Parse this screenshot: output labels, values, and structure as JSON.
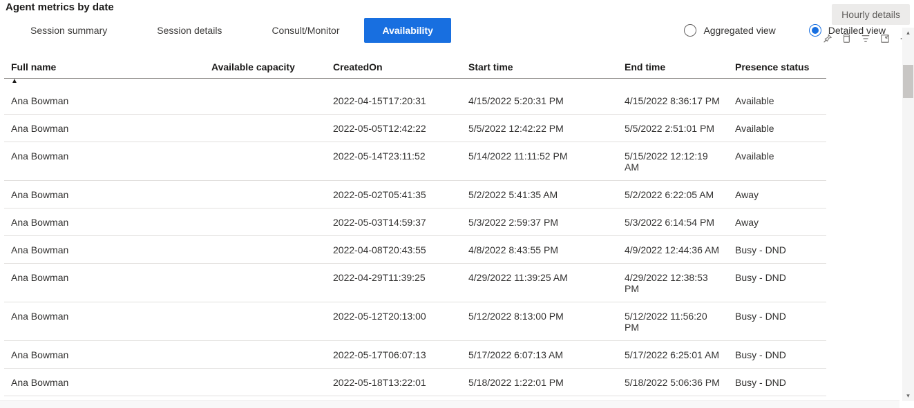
{
  "title": "Agent metrics by date",
  "tabs": [
    {
      "label": "Session summary",
      "active": false
    },
    {
      "label": "Session details",
      "active": false
    },
    {
      "label": "Consult/Monitor",
      "active": false
    },
    {
      "label": "Availability",
      "active": true
    }
  ],
  "view": {
    "aggregated_label": "Aggregated view",
    "detailed_label": "Detailed view",
    "selected": "detailed"
  },
  "right_rail": {
    "hourly_label": "Hourly details"
  },
  "columns": {
    "full_name": "Full name",
    "available_capacity": "Available capacity",
    "created_on": "CreatedOn",
    "start_time": "Start time",
    "end_time": "End time",
    "presence_status": "Presence status"
  },
  "sort_indicator": "▲",
  "rows": [
    {
      "name": "Ana Bowman",
      "capacity": "",
      "created": "2022-04-15T17:20:31",
      "start": "4/15/2022 5:20:31 PM",
      "end": "4/15/2022 8:36:17 PM",
      "status": "Available"
    },
    {
      "name": "Ana Bowman",
      "capacity": "",
      "created": "2022-05-05T12:42:22",
      "start": "5/5/2022 12:42:22 PM",
      "end": "5/5/2022 2:51:01 PM",
      "status": "Available"
    },
    {
      "name": "Ana Bowman",
      "capacity": "",
      "created": "2022-05-14T23:11:52",
      "start": "5/14/2022 11:11:52 PM",
      "end": "5/15/2022 12:12:19 AM",
      "status": "Available"
    },
    {
      "name": "Ana Bowman",
      "capacity": "",
      "created": "2022-05-02T05:41:35",
      "start": "5/2/2022 5:41:35 AM",
      "end": "5/2/2022 6:22:05 AM",
      "status": "Away"
    },
    {
      "name": "Ana Bowman",
      "capacity": "",
      "created": "2022-05-03T14:59:37",
      "start": "5/3/2022 2:59:37 PM",
      "end": "5/3/2022 6:14:54 PM",
      "status": "Away"
    },
    {
      "name": "Ana Bowman",
      "capacity": "",
      "created": "2022-04-08T20:43:55",
      "start": "4/8/2022 8:43:55 PM",
      "end": "4/9/2022 12:44:36 AM",
      "status": "Busy - DND"
    },
    {
      "name": "Ana Bowman",
      "capacity": "",
      "created": "2022-04-29T11:39:25",
      "start": "4/29/2022 11:39:25 AM",
      "end": "4/29/2022 12:38:53 PM",
      "status": "Busy - DND"
    },
    {
      "name": "Ana Bowman",
      "capacity": "",
      "created": "2022-05-12T20:13:00",
      "start": "5/12/2022 8:13:00 PM",
      "end": "5/12/2022 11:56:20 PM",
      "status": "Busy - DND"
    },
    {
      "name": "Ana Bowman",
      "capacity": "",
      "created": "2022-05-17T06:07:13",
      "start": "5/17/2022 6:07:13 AM",
      "end": "5/17/2022 6:25:01 AM",
      "status": "Busy - DND"
    },
    {
      "name": "Ana Bowman",
      "capacity": "",
      "created": "2022-05-18T13:22:01",
      "start": "5/18/2022 1:22:01 PM",
      "end": "5/18/2022 5:06:36 PM",
      "status": "Busy - DND"
    }
  ]
}
